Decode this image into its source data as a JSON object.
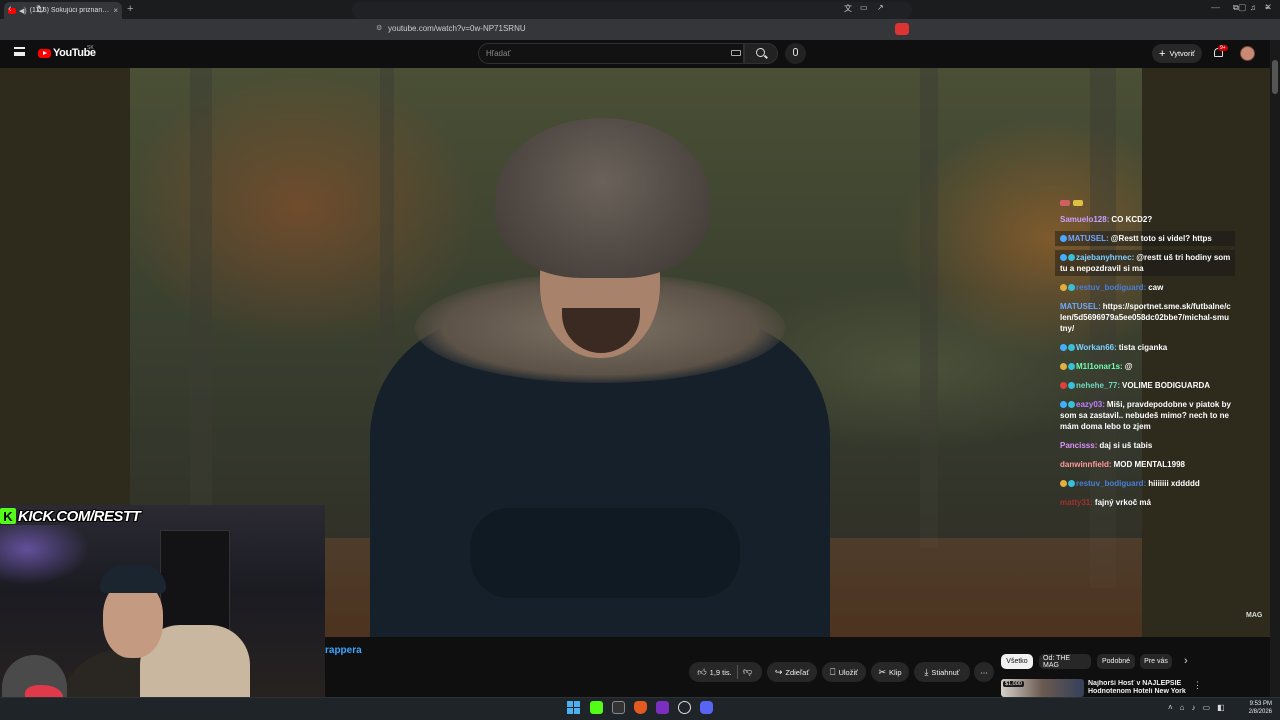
{
  "browser": {
    "tab_title": "(1115) Šokujúci priznanie, ktoré",
    "tab_close": "×",
    "new_tab": "+",
    "url": "youtube.com/watch?v=0w-NP71SRNU",
    "window_controls": [
      "—",
      "▢",
      "✕"
    ]
  },
  "youtube": {
    "logo_text": "YouTube",
    "country_code": "SK",
    "search_placeholder": "Hľadať",
    "create_label": "Vytvoriť",
    "notification_count": "9+"
  },
  "video": {
    "watermark": "MAG",
    "title_fragment": "rappera"
  },
  "chat": [
    {
      "user": "Samuelo128:",
      "text": "CO KCD2?",
      "user_color": "#c9a0ff",
      "badges": [],
      "highlight": false
    },
    {
      "user": "MATUSEL:",
      "text": "@Restt toto si videl? https",
      "user_color": "#6fa8ff",
      "badges": [
        "#4aa8ff"
      ],
      "highlight": true
    },
    {
      "user": "zajebanyhrnec:",
      "text": "@restt uš tri hodiny som tu a nepozdravil si ma",
      "user_color": "#7fd0ff",
      "badges": [
        "#3fb0ff",
        "#38c0d8"
      ],
      "highlight": true
    },
    {
      "user": "restuv_bodiguard:",
      "text": "caw",
      "user_color": "#4a7fd6",
      "badges": [
        "#e0b040",
        "#38c0d8"
      ],
      "highlight": false
    },
    {
      "user": "MATUSEL:",
      "text": "https://sportnet.sme.sk/futbalne/clen/5d5696979a5ee058dc02bbe7/michal-smutny/",
      "user_color": "#6fa8ff",
      "badges": [],
      "highlight": false
    },
    {
      "user": "Workan66:",
      "text": "tista ciganka",
      "user_color": "#7fd0ff",
      "badges": [
        "#3fb0ff",
        "#38c0d8"
      ],
      "highlight": false
    },
    {
      "user": "M1l1onar1s:",
      "text": "@",
      "user_color": "#6fffb0",
      "badges": [
        "#e0b040",
        "#38c0d8"
      ],
      "highlight": false
    },
    {
      "user": "nehehe_77:",
      "text": "VOLIME BODIGUARDA",
      "user_color": "#6fd6c0",
      "badges": [
        "#e04040",
        "#38c0d8"
      ],
      "highlight": false
    },
    {
      "user": "eazy03:",
      "text": "Miši, pravdepodobne v piatok by som sa zastavil.. nebudeš mimo? nech to nemám doma lebo to zjem",
      "user_color": "#c080ff",
      "badges": [
        "#3fb0ff",
        "#38c0d8"
      ],
      "highlight": false
    },
    {
      "user": "Pancisss:",
      "text": "daj si uš tabis",
      "user_color": "#e090ff",
      "badges": [],
      "highlight": false
    },
    {
      "user": "danwinnfield:",
      "text": "MOD MENTAL1998",
      "user_color": "#ff9a9a",
      "badges": [],
      "highlight": false
    },
    {
      "user": "restuv_bodiguard:",
      "text": "hiiiiiii xddddd",
      "user_color": "#4a7fd6",
      "badges": [
        "#e0b040",
        "#38c0d8"
      ],
      "highlight": false
    },
    {
      "user": "matty31:",
      "text": "fajný vrkoč má",
      "user_color": "#a03030",
      "badges": [],
      "highlight": false
    }
  ],
  "stream_overlay": {
    "kick_logo": "K",
    "kick_url": "KICK.COM/RESTT"
  },
  "actions": {
    "like_count": "1,9 tis.",
    "share": "Zdieľať",
    "save": "Uložiť",
    "clip": "Klip",
    "download": "Stiahnuť",
    "more": "⋯"
  },
  "chips": [
    "Všetko",
    "Od: THE MAG",
    "Podobné",
    "Pre vás"
  ],
  "recommendation": {
    "badge": "$1,000",
    "title_line1": "Najhorší Hosť v NAJLEPŠIE",
    "title_line2": "Hodnotenom Hoteli New York"
  },
  "clock": {
    "time": "9:53 PM",
    "date": "2/8/2026"
  },
  "colors": {
    "youtube_red": "#ff0000",
    "kick_green": "#53fc18",
    "link_blue": "#3ea6ff"
  }
}
